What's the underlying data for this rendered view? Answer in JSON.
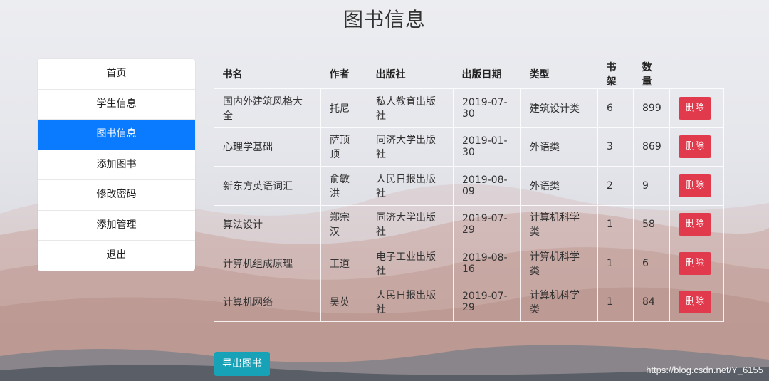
{
  "page": {
    "title": "图书信息"
  },
  "sidebar": {
    "items": [
      {
        "label": "首页"
      },
      {
        "label": "学生信息"
      },
      {
        "label": "图书信息"
      },
      {
        "label": "添加图书"
      },
      {
        "label": "修改密码"
      },
      {
        "label": "添加管理"
      },
      {
        "label": "退出"
      }
    ],
    "active_index": 2,
    "active_color": "#0a7bff"
  },
  "table": {
    "headers": [
      "书名",
      "作者",
      "出版社",
      "出版日期",
      "类型",
      "书架",
      "数量"
    ],
    "rows": [
      [
        "国内外建筑风格大全",
        "托尼",
        "私人教育出版社",
        "2019-07-30",
        "建筑设计类",
        "6",
        "899"
      ],
      [
        "心理学基础",
        "萨顶顶",
        "同济大学出版社",
        "2019-01-30",
        "外语类",
        "3",
        "869"
      ],
      [
        "新东方英语词汇",
        "俞敏洪",
        "人民日报出版社",
        "2019-08-09",
        "外语类",
        "2",
        "9"
      ],
      [
        "算法设计",
        "郑宗汉",
        "同济大学出版社",
        "2019-07-29",
        "计算机科学类",
        "1",
        "58"
      ],
      [
        "计算机组成原理",
        "王道",
        "电子工业出版社",
        "2019-08-16",
        "计算机科学类",
        "1",
        "6"
      ],
      [
        "计算机网络",
        "吴英",
        "人民日报出版社",
        "2019-07-29",
        "计算机科学类",
        "1",
        "84"
      ]
    ],
    "delete_label": "删除",
    "delete_color": "#e13a4c"
  },
  "export": {
    "label": "导出图书",
    "color": "#17a2b8"
  },
  "watermark": "https://blog.csdn.net/Y_6155"
}
